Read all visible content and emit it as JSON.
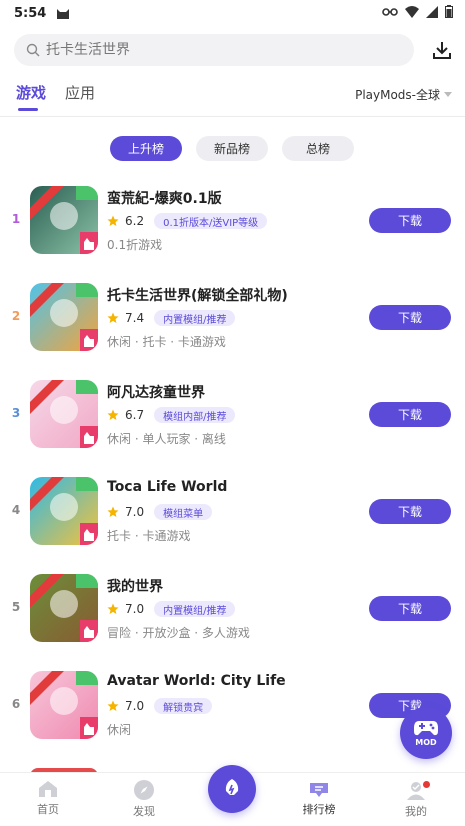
{
  "status": {
    "time": "5:54"
  },
  "search": {
    "placeholder": "托卡生活世界"
  },
  "tabs": [
    {
      "label": "游戏",
      "active": true
    },
    {
      "label": "应用",
      "active": false
    }
  ],
  "region": "PlayMods-全球",
  "chips": [
    "上升榜",
    "新品榜",
    "总榜"
  ],
  "apps": [
    {
      "rank": "1",
      "rank_color": "#b15bd8",
      "title": "蛮荒紀-爆爽0.1版",
      "rating": "6.2",
      "tag": "0.1折版本/送VIP等级",
      "categories": "0.1折游戏",
      "button": "下载",
      "icon_text": "0.1折",
      "icon_colors": [
        "#2b5e52",
        "#8cc3a8"
      ]
    },
    {
      "rank": "2",
      "rank_color": "#f19a5a",
      "title": "托卡生活世界(解锁全部礼物)",
      "rating": "7.4",
      "tag": "内置模组/推荐",
      "categories": "休闲 · 托卡 · 卡通游戏",
      "button": "下载",
      "icon_text": "",
      "icon_colors": [
        "#4fc3e8",
        "#f5a33a"
      ]
    },
    {
      "rank": "3",
      "rank_color": "#5b8fd8",
      "title": "阿凡达孩童世界",
      "rating": "6.7",
      "tag": "模组内部/推荐",
      "categories": "休闲 · 单人玩家 · 离线",
      "button": "下载",
      "icon_text": "",
      "icon_colors": [
        "#f6d8e8",
        "#f1a8c5"
      ]
    },
    {
      "rank": "4",
      "rank_color": "#888888",
      "title": "Toca Life World",
      "rating": "7.0",
      "tag": "模组菜单",
      "categories": "托卡 · 卡通游戏",
      "button": "下载",
      "icon_text": "",
      "icon_colors": [
        "#2fb9e6",
        "#f5c23a"
      ]
    },
    {
      "rank": "5",
      "rank_color": "#888888",
      "title": "我的世界",
      "rating": "7.0",
      "tag": "内置模组/推荐",
      "categories": "冒险 · 开放沙盒 · 多人游戏",
      "button": "下载",
      "icon_text": "",
      "icon_colors": [
        "#6b8e3a",
        "#8a5a32"
      ]
    },
    {
      "rank": "6",
      "rank_color": "#888888",
      "title": "Avatar World: City Life",
      "rating": "7.0",
      "tag": "解锁贵宾",
      "categories": "休闲",
      "button": "下载",
      "icon_text": "PAZU",
      "icon_colors": [
        "#f7c6d9",
        "#f08ab0"
      ]
    }
  ],
  "float_button": {
    "label": "MOD"
  },
  "nav": [
    {
      "label": "首页"
    },
    {
      "label": "发现"
    },
    {
      "label": "排行榜"
    },
    {
      "label": "我的"
    }
  ],
  "colors": {
    "accent": "#5b4bd8",
    "tag_bg": "#ece9fd",
    "star": "#f5b400"
  }
}
